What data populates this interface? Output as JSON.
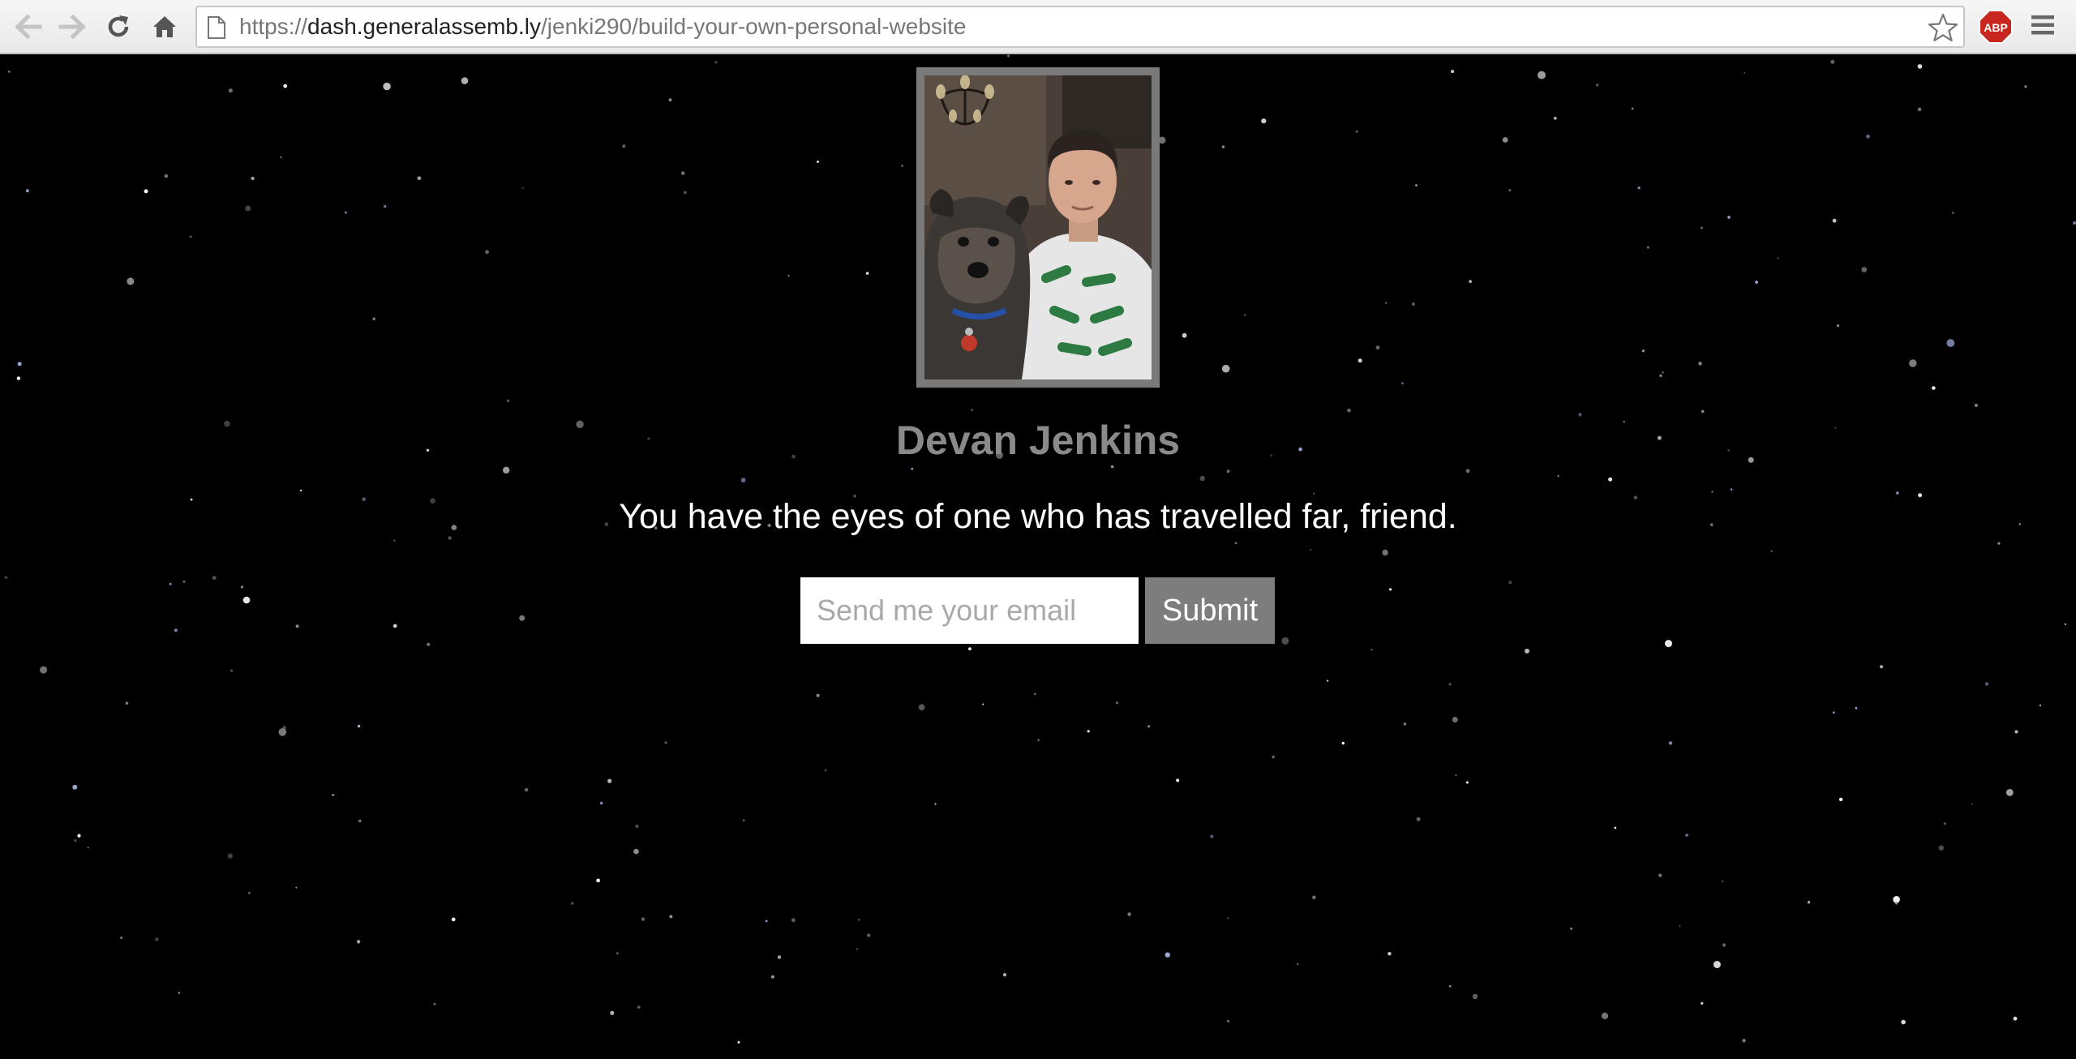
{
  "browser": {
    "url_prefix": "https://",
    "url_host": "dash.generalassemb.ly",
    "url_path": "/jenki290/build-your-own-personal-website",
    "icons": [
      "back-arrow-icon",
      "forward-arrow-icon",
      "reload-icon",
      "home-icon",
      "page-icon",
      "bookmark-star-icon",
      "adblock-plus-icon",
      "menu-icon"
    ],
    "abp_label": "ABP"
  },
  "profile": {
    "name": "Devan Jenkins",
    "tagline": "You have the eyes of one who has travelled far, friend.",
    "frame_color": "#7a7a7a",
    "name_color": "#8a8a8a"
  },
  "signup": {
    "email_placeholder": "Send me your email",
    "email_value": "",
    "submit_label": "Submit",
    "button_color": "#7d7d7d"
  }
}
